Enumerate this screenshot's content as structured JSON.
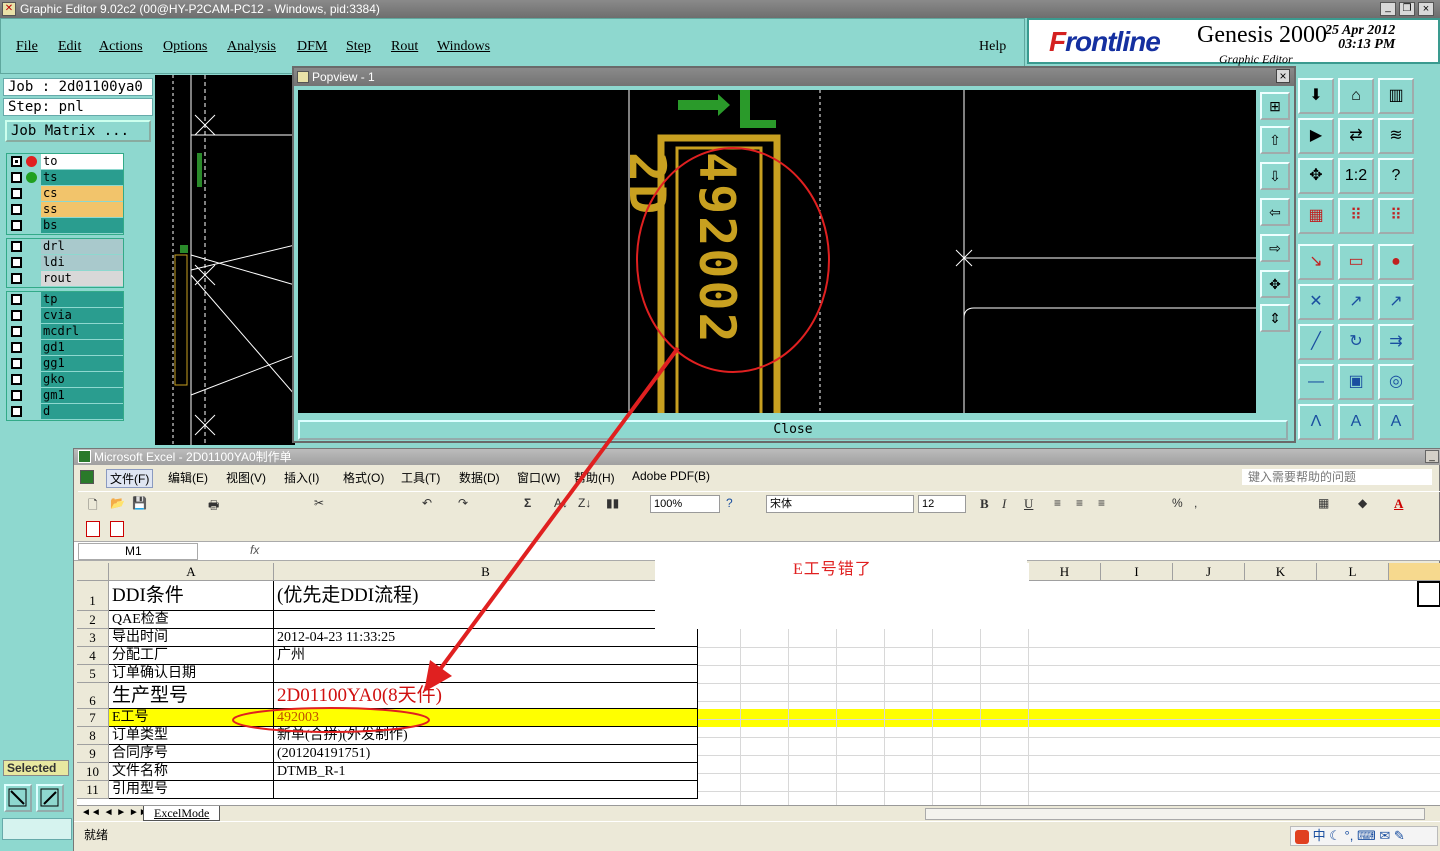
{
  "genesis": {
    "title": "Graphic Editor 9.02c2 (00@HY-P2CAM-PC12 - Windows, pid:3384)",
    "menu": [
      "File",
      "Edit",
      "Actions",
      "Options",
      "Analysis",
      "DFM",
      "Step",
      "Rout",
      "Windows"
    ],
    "help": "Help",
    "logo": {
      "brand_prefix": "F",
      "brand_rest": "rontline",
      "product": "Genesis 2000",
      "subtitle": "Graphic Editor",
      "date": "25 Apr 2012",
      "time": "03:13 PM"
    },
    "job": "Job : 2d01100ya0",
    "step": "Step: pnl",
    "job_matrix": "Job Matrix ...",
    "layer_groups": [
      [
        {
          "name": "to",
          "color": "#ffffff",
          "dot": "#e02020",
          "checked": true
        },
        {
          "name": "ts",
          "color": "#2a9d8f",
          "dot": "#20a020",
          "checked": false
        },
        {
          "name": "cs",
          "color": "#f2c46b",
          "checked": false
        },
        {
          "name": "ss",
          "color": "#f2c46b",
          "checked": false
        },
        {
          "name": "bs",
          "color": "#2a9d8f",
          "checked": false
        }
      ],
      [
        {
          "name": "drl",
          "color": "#a9c9cc",
          "checked": false
        },
        {
          "name": "ldi",
          "color": "#a9c9cc",
          "checked": false
        },
        {
          "name": "rout",
          "color": "#d8d8d8",
          "checked": false
        }
      ],
      [
        {
          "name": "tp",
          "color": "#2a9d8f",
          "checked": false
        },
        {
          "name": "cvia",
          "color": "#2a9d8f",
          "checked": false
        },
        {
          "name": "mcdrl",
          "color": "#2a9d8f",
          "checked": false
        },
        {
          "name": "gd1",
          "color": "#2a9d8f",
          "checked": false
        },
        {
          "name": "gg1",
          "color": "#2a9d8f",
          "checked": false
        },
        {
          "name": "gko",
          "color": "#2a9d8f",
          "checked": false
        },
        {
          "name": "gm1",
          "color": "#2a9d8f",
          "checked": false
        },
        {
          "name": "d",
          "color": "#2a9d8f",
          "checked": false
        }
      ]
    ],
    "selected_label": "Selected"
  },
  "popview": {
    "title": "Popview - 1",
    "close_x": "×",
    "close_button": "Close",
    "board_text": "492002 2D"
  },
  "excel": {
    "title": "Microsoft Excel - 2D01100YA0制作单",
    "menu": [
      "文件(F)",
      "编辑(E)",
      "视图(V)",
      "插入(I)",
      "格式(O)",
      "工具(T)",
      "数据(D)",
      "窗口(W)",
      "帮助(H)",
      "Adobe PDF(B)"
    ],
    "help_placeholder": "键入需要帮助的问题",
    "zoom": "100%",
    "font": "宋体",
    "font_size": "12",
    "name_box": "M1",
    "fx": "fx",
    "columns": [
      "A",
      "B",
      "H",
      "I",
      "J",
      "K",
      "L"
    ],
    "rows": [
      {
        "n": "1",
        "a": "DDI条件",
        "b": "(优先走DDI流程)"
      },
      {
        "n": "2",
        "a": "QAE检查",
        "b": ""
      },
      {
        "n": "3",
        "a": "导出时间",
        "b": "2012-04-23 11:33:25"
      },
      {
        "n": "4",
        "a": "分配工厂",
        "b": "广州"
      },
      {
        "n": "5",
        "a": "订单确认日期",
        "b": ""
      },
      {
        "n": "6",
        "a": "生产型号",
        "b": "2D01100YA0(8天件)"
      },
      {
        "n": "7",
        "a": "E工号",
        "b": "492003"
      },
      {
        "n": "8",
        "a": "订单类型",
        "b": "新单(合拼)(外发制作)"
      },
      {
        "n": "9",
        "a": "合同序号",
        "b": "(201204191751)"
      },
      {
        "n": "10",
        "a": "文件名称",
        "b": "DTMB_R-1"
      },
      {
        "n": "11",
        "a": "引用型号",
        "b": ""
      }
    ],
    "sheet_tab": "ExcelMode",
    "status": "就绪"
  },
  "annotation": {
    "note": "E工号错了"
  },
  "ime": {
    "label": "中"
  }
}
